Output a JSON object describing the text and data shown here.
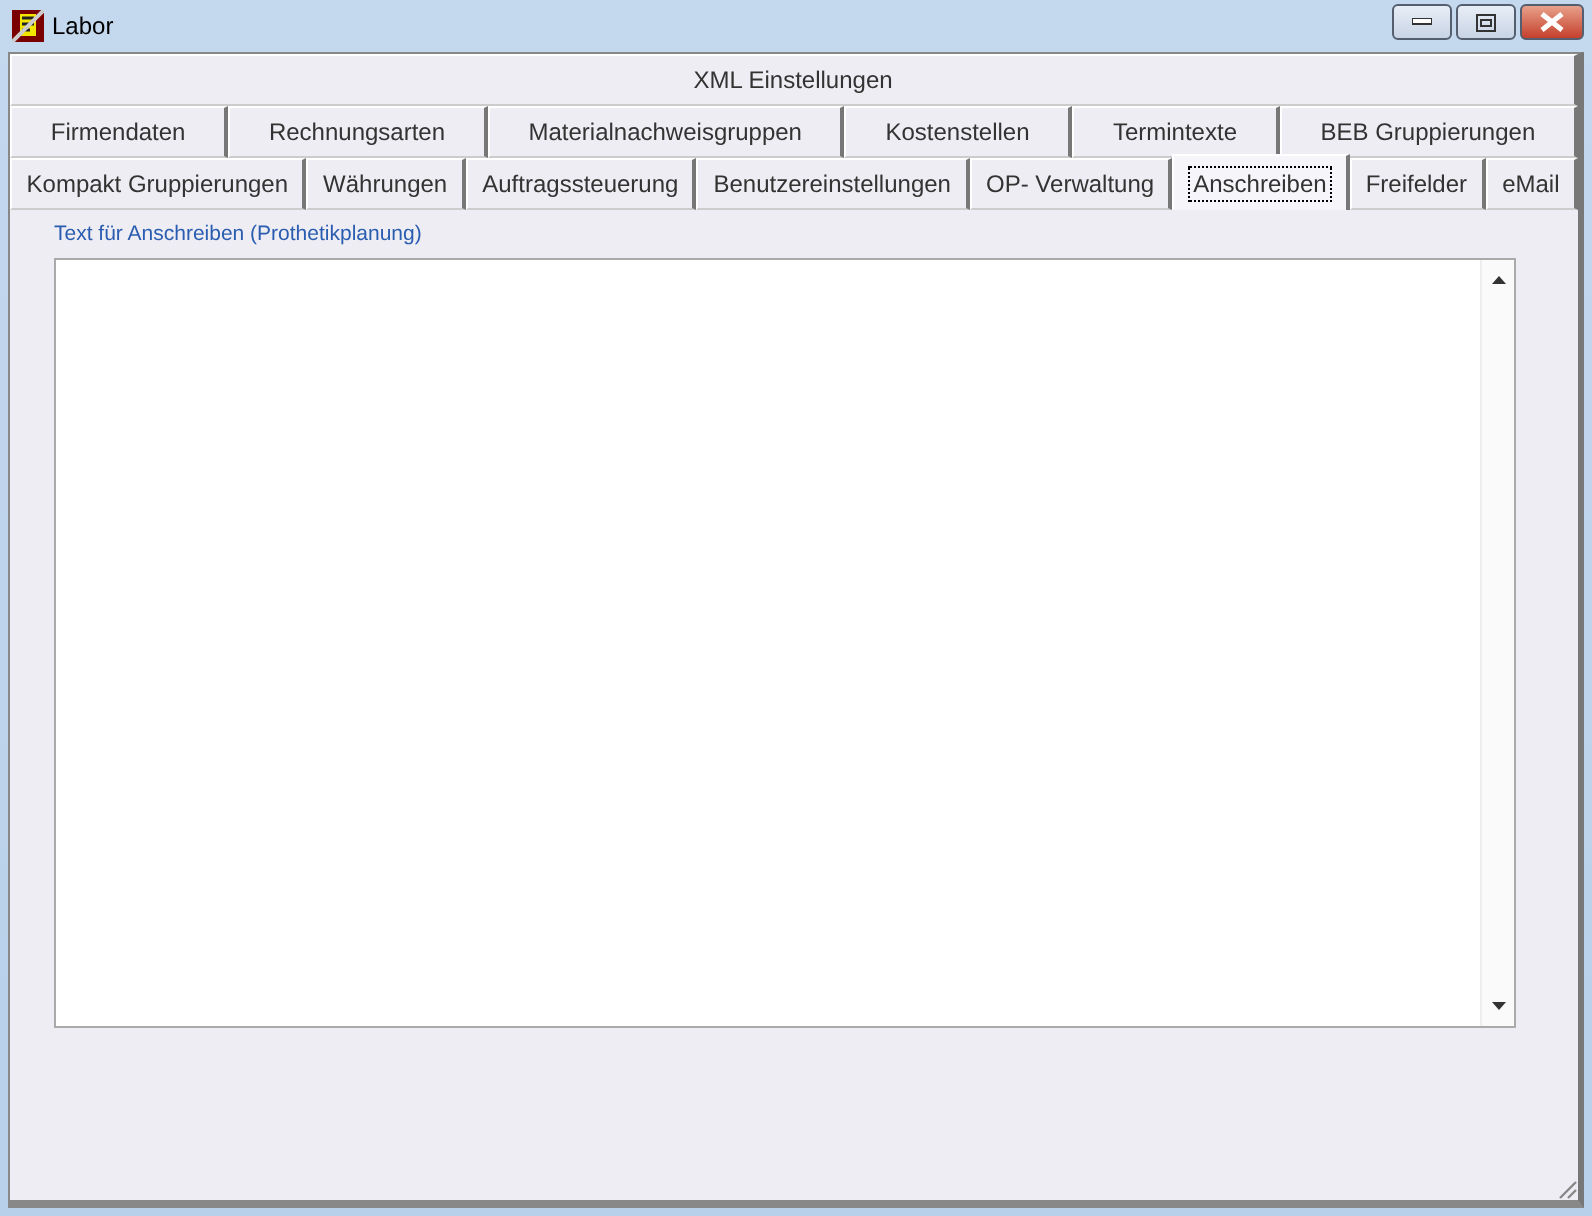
{
  "window": {
    "title": "Labor"
  },
  "tab_rows": [
    [
      {
        "label": "XML Einstellungen",
        "selected": false
      }
    ],
    [
      {
        "label": "Firmendaten",
        "selected": false
      },
      {
        "label": "Rechnungsarten",
        "selected": false
      },
      {
        "label": "Materialnachweisgruppen",
        "selected": false
      },
      {
        "label": "Kostenstellen",
        "selected": false
      },
      {
        "label": "Termintexte",
        "selected": false
      },
      {
        "label": "BEB Gruppierungen",
        "selected": false
      }
    ],
    [
      {
        "label": "Kompakt Gruppierungen",
        "selected": false
      },
      {
        "label": "Währungen",
        "selected": false
      },
      {
        "label": "Auftragssteuerung",
        "selected": false
      },
      {
        "label": "Benutzereinstellungen",
        "selected": false
      },
      {
        "label": "OP- Verwaltung",
        "selected": false
      },
      {
        "label": "Anschreiben",
        "selected": true
      },
      {
        "label": "Freifelder",
        "selected": false
      },
      {
        "label": "eMail",
        "selected": false
      }
    ]
  ],
  "panel": {
    "label": "Text für Anschreiben (Prothetikplanung)"
  }
}
